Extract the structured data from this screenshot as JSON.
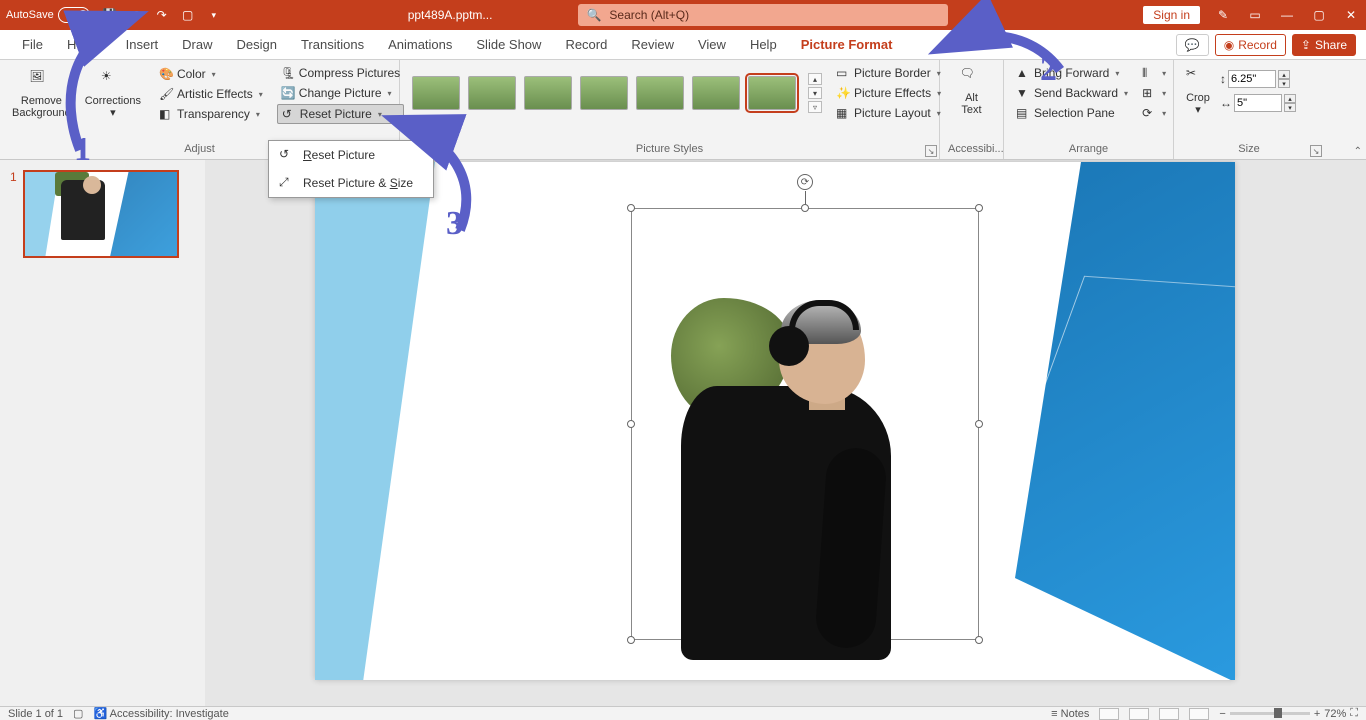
{
  "title": {
    "autosave": "AutoSave",
    "autosave_state": "Off",
    "filename": "ppt489A.pptm...",
    "search_placeholder": "Search (Alt+Q)",
    "signin": "Sign in"
  },
  "tabs": {
    "file": "File",
    "home": "Home",
    "insert": "Insert",
    "draw": "Draw",
    "design": "Design",
    "transitions": "Transitions",
    "animations": "Animations",
    "slideshow": "Slide Show",
    "record_tab": "Record",
    "review": "Review",
    "view": "View",
    "help": "Help",
    "picture_format": "Picture Format",
    "record_btn": "Record",
    "share": "Share"
  },
  "ribbon": {
    "adjust": {
      "remove_bg_l1": "Remove",
      "remove_bg_l2": "Background",
      "corrections": "Corrections",
      "color": "Color",
      "artistic": "Artistic Effects",
      "transparency": "Transparency",
      "compress": "Compress Pictures",
      "change": "Change Picture",
      "reset": "Reset Picture",
      "label": "Adjust"
    },
    "styles": {
      "border": "Picture Border",
      "effects": "Picture Effects",
      "layout": "Picture Layout",
      "label": "Picture Styles"
    },
    "access": {
      "alt_l1": "Alt",
      "alt_l2": "Text",
      "label": "Accessibi..."
    },
    "arrange": {
      "forward": "Bring Forward",
      "backward": "Send Backward",
      "selpane": "Selection Pane",
      "label": "Arrange"
    },
    "size": {
      "crop": "Crop",
      "height": "6.25\"",
      "width": "5\"",
      "label": "Size"
    }
  },
  "dropdown": {
    "reset_picture": "Reset Picture",
    "reset_size": "Reset Picture & Size",
    "reset_picture_key": "R",
    "reset_size_key": "S"
  },
  "slidepane": {
    "num": "1"
  },
  "status": {
    "slide": "Slide 1 of 1",
    "access": "Accessibility: Investigate",
    "notes": "Notes",
    "zoom": "72%"
  },
  "anno": {
    "n1": "1",
    "n2": "2",
    "n3": "3"
  }
}
